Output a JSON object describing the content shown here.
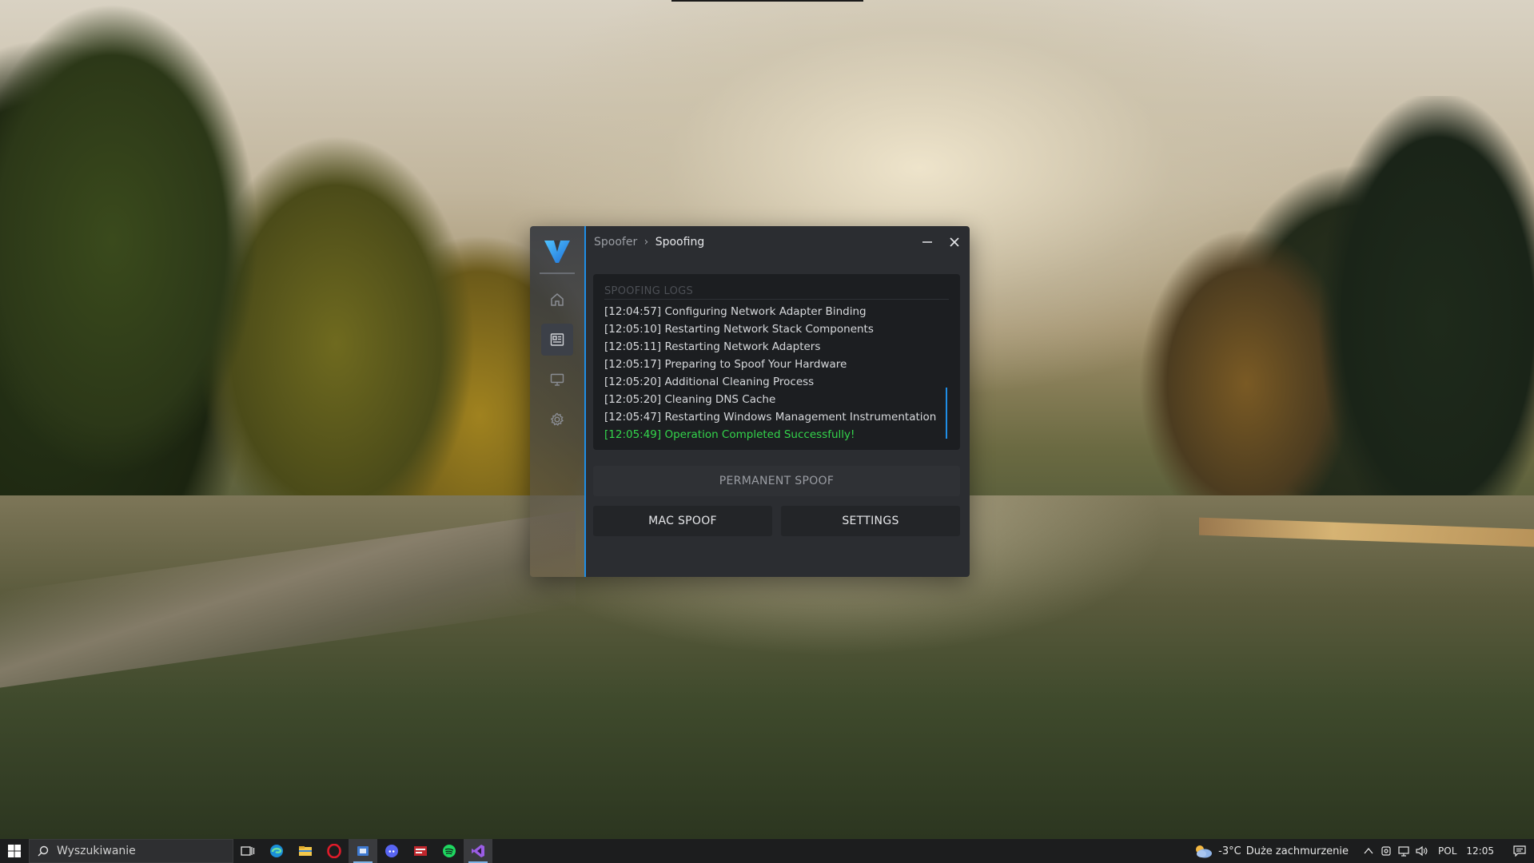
{
  "app": {
    "breadcrumb_parent": "Spoofer",
    "breadcrumb_sep": "›",
    "breadcrumb_current": "Spoofing",
    "accent": "#1f8ee6",
    "nav": [
      {
        "name": "home",
        "icon": "home-icon"
      },
      {
        "name": "spoofing",
        "icon": "news-icon",
        "active": true
      },
      {
        "name": "monitor",
        "icon": "monitor-icon"
      },
      {
        "name": "settings",
        "icon": "gear-icon"
      }
    ],
    "logs": {
      "title": "SPOOFING LOGS",
      "lines": [
        "[12:04:57] Configuring Network Adapter Binding",
        "[12:05:10] Restarting Network Stack Components",
        "[12:05:11] Restarting Network Adapters",
        "[12:05:17] Preparing to Spoof Your Hardware",
        "[12:05:20] Additional Cleaning Process",
        "[12:05:20] Cleaning DNS Cache",
        "[12:05:47] Restarting Windows Management Instrumentation"
      ],
      "success_line": "[12:05:49] Operation Completed Successfully!",
      "success_color": "#33d44b"
    },
    "buttons": {
      "permanent": "PERMANENT SPOOF",
      "mac": "MAC SPOOF",
      "settings": "SETTINGS"
    }
  },
  "taskbar": {
    "search_placeholder": "Wyszukiwanie",
    "apps": [
      "task-view-icon",
      "edge-icon",
      "file-explorer-icon",
      "opera-icon",
      "spoofer-app-icon",
      "discord-icon",
      "media-app-icon",
      "spotify-icon",
      "visual-studio-icon"
    ],
    "weather_temp": "-3°C",
    "weather_text": "Duże zachmurzenie",
    "language": "POL",
    "time": "12:05"
  }
}
